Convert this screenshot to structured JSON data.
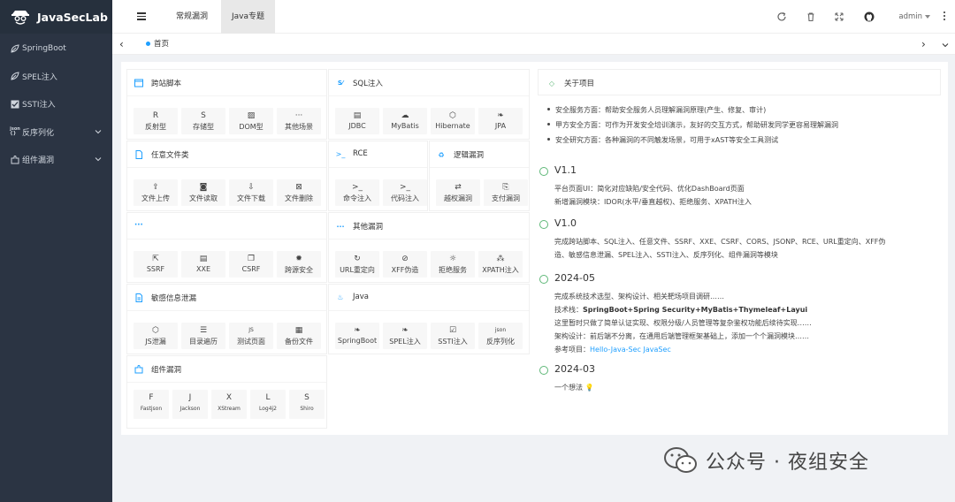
{
  "app": {
    "title": "JavaSecLab"
  },
  "sidebar": {
    "items": [
      {
        "label": "SpringBoot",
        "icon": "leaf-icon",
        "has_chevron": false
      },
      {
        "label": "SPEL注入",
        "icon": "leaf-icon",
        "has_chevron": false
      },
      {
        "label": "SSTI注入",
        "icon": "checkbox-icon",
        "has_chevron": false
      },
      {
        "label": "反序列化",
        "icon": "json-icon",
        "has_chevron": true
      },
      {
        "label": "组件漏洞",
        "icon": "puzzle-icon",
        "has_chevron": true
      }
    ]
  },
  "header": {
    "tabs": [
      {
        "label": "常规漏洞"
      },
      {
        "label": "Java专题",
        "active": true
      }
    ],
    "user": "admin"
  },
  "tabbar": {
    "home": "首页"
  },
  "cards": {
    "xss": {
      "title": "跨站脚本",
      "buttons": [
        {
          "icon": "R",
          "label": "反射型"
        },
        {
          "icon": "S",
          "label": "存储型"
        },
        {
          "icon": "image-icon",
          "label": "DOM型"
        },
        {
          "icon": "···",
          "label": "其他场景"
        }
      ]
    },
    "sql": {
      "title": "SQL注入",
      "buttons": [
        {
          "icon": "database-icon",
          "label": "JDBC"
        },
        {
          "icon": "bird-icon",
          "label": "MyBatis"
        },
        {
          "icon": "hex-icon",
          "label": "Hibernate"
        },
        {
          "icon": "leaf-icon",
          "label": "JPA"
        }
      ]
    },
    "file": {
      "title": "任意文件类",
      "buttons": [
        {
          "icon": "upload-icon",
          "label": "文件上传"
        },
        {
          "icon": "read-icon",
          "label": "文件读取"
        },
        {
          "icon": "download-icon",
          "label": "文件下载"
        },
        {
          "icon": "delete-icon",
          "label": "文件删除"
        }
      ]
    },
    "rce": {
      "title": "RCE",
      "buttons": [
        {
          "icon": ">_",
          "label": "命令注入"
        },
        {
          "icon": ">_",
          "label": "代码注入"
        }
      ]
    },
    "logic": {
      "title": "逻辑漏洞",
      "buttons": [
        {
          "icon": "swap-icon",
          "label": "越权漏洞"
        },
        {
          "icon": "pay-icon",
          "label": "支付漏洞"
        }
      ]
    },
    "req": {
      "title": "···",
      "buttons": [
        {
          "icon": "external-icon",
          "label": "SSRF"
        },
        {
          "icon": "doc-icon",
          "label": "XXE"
        },
        {
          "icon": "copy-icon",
          "label": "CSRF"
        },
        {
          "icon": "gear-icon",
          "label": "跨源安全"
        }
      ]
    },
    "other": {
      "title": "其他漏洞",
      "buttons": [
        {
          "icon": "redirect-icon",
          "label": "URL重定向"
        },
        {
          "icon": "compass-icon",
          "label": "XFF伪造"
        },
        {
          "icon": "sun-icon",
          "label": "拒绝服务"
        },
        {
          "icon": "tree-icon",
          "label": "XPATH注入"
        }
      ]
    },
    "leak": {
      "title": "敏感信息泄漏",
      "buttons": [
        {
          "icon": "hex-icon",
          "label": "JS泄漏"
        },
        {
          "icon": "list-icon",
          "label": "目录遍历"
        },
        {
          "icon": "js-icon",
          "label": "测试页面"
        },
        {
          "icon": "backup-icon",
          "label": "备份文件"
        }
      ]
    },
    "java": {
      "title": "Java",
      "buttons": [
        {
          "icon": "leaf-icon",
          "label": "SpringBoot"
        },
        {
          "icon": "leaf-icon",
          "label": "SPEL注入"
        },
        {
          "icon": "checkbox-icon",
          "label": "SSTI注入"
        },
        {
          "icon": "json-icon",
          "label": "反序列化"
        }
      ]
    },
    "comp": {
      "title": "组件漏洞",
      "buttons": [
        {
          "icon": "F",
          "label": "Fastjson"
        },
        {
          "icon": "J",
          "label": "Jackson"
        },
        {
          "icon": "X",
          "label": "XStream"
        },
        {
          "icon": "L",
          "label": "Log4j2"
        },
        {
          "icon": "S",
          "label": "Shiro"
        }
      ]
    }
  },
  "about": {
    "title": "关于项目",
    "items": [
      "安全服务方面：帮助安全服务人员理解漏洞原理(产生、修复、审计)",
      "甲方安全方面：可作为开发安全培训演示，友好的交互方式，帮助研发同学更容易理解漏洞",
      "安全研究方面：各种漏洞的不同触发场景，可用于xAST等安全工具测试"
    ]
  },
  "timeline": [
    {
      "title": "V1.1",
      "lines": [
        "平台页面UI：简化对应缺陷/安全代码、优化DashBoard页面",
        "新增漏洞模块：IDOR(水平/垂直越权)、拒绝服务、XPATH注入"
      ]
    },
    {
      "title": "V1.0",
      "lines": [
        "完成跨站脚本、SQL注入、任意文件、SSRF、XXE、CSRF、CORS、JSONP、RCE、URL重定向、XFF伪",
        "造、敏感信息泄漏、SPEL注入、SSTI注入、反序列化、组件漏洞等模块"
      ]
    },
    {
      "title": "2024-05",
      "lines": [
        "完成系统技术选型、架构设计、相关靶场项目调研……",
        "技术栈：",
        "这里暂时只做了简单认证实现、权限分级/人员管理等复杂鉴权功能后续待实现……",
        "架构设计：前后端不分离，在通用后端管理框架基础上，添加一个个漏洞模块……",
        "参考项目："
      ],
      "stack": "SpringBoot+Spring Security+MyBatis+Thymeleaf+Layui",
      "ref": "Hello-Java-Sec JavaSec"
    },
    {
      "title": "2024-03",
      "lines": [
        "一个想法"
      ]
    }
  ],
  "watermark": "公众号 · 夜组安全"
}
